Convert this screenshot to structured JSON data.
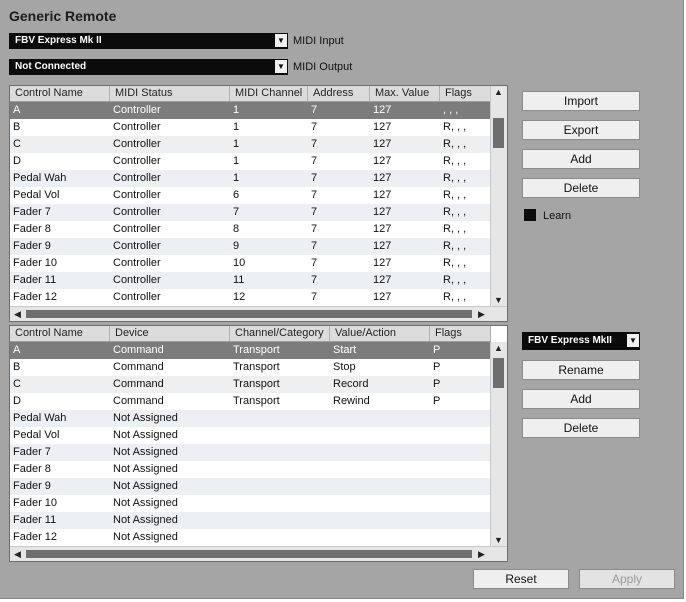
{
  "title": "Generic Remote",
  "midi_input": {
    "value": "FBV Express Mk II",
    "label": "MIDI Input"
  },
  "midi_output": {
    "value": "Not Connected",
    "label": "MIDI Output"
  },
  "top_table": {
    "headers": [
      "Control Name",
      "MIDI Status",
      "MIDI Channel",
      "Address",
      "Max. Value",
      "Flags"
    ],
    "rows": [
      [
        "A",
        "Controller",
        "1",
        "7",
        "127",
        ", , ,"
      ],
      [
        "B",
        "Controller",
        "1",
        "7",
        "127",
        "R, , ,"
      ],
      [
        "C",
        "Controller",
        "1",
        "7",
        "127",
        "R, , ,"
      ],
      [
        "D",
        "Controller",
        "1",
        "7",
        "127",
        "R, , ,"
      ],
      [
        "Pedal Wah",
        "Controller",
        "1",
        "7",
        "127",
        "R, , ,"
      ],
      [
        "Pedal Vol",
        "Controller",
        "6",
        "7",
        "127",
        "R, , ,"
      ],
      [
        "Fader 7",
        "Controller",
        "7",
        "7",
        "127",
        "R, , ,"
      ],
      [
        "Fader 8",
        "Controller",
        "8",
        "7",
        "127",
        "R, , ,"
      ],
      [
        "Fader 9",
        "Controller",
        "9",
        "7",
        "127",
        "R, , ,"
      ],
      [
        "Fader 10",
        "Controller",
        "10",
        "7",
        "127",
        "R, , ,"
      ],
      [
        "Fader 11",
        "Controller",
        "11",
        "7",
        "127",
        "R, , ,"
      ],
      [
        "Fader 12",
        "Controller",
        "12",
        "7",
        "127",
        "R, , ,"
      ]
    ]
  },
  "top_buttons": {
    "import": "Import",
    "export": "Export",
    "add": "Add",
    "delete": "Delete"
  },
  "learn_label": "Learn",
  "bottom_table": {
    "headers": [
      "Control Name",
      "Device",
      "Channel/Category",
      "Value/Action",
      "Flags"
    ],
    "rows": [
      [
        "A",
        "Command",
        "Transport",
        "Start",
        "P"
      ],
      [
        "B",
        "Command",
        "Transport",
        "Stop",
        "P"
      ],
      [
        "C",
        "Command",
        "Transport",
        "Record",
        "P"
      ],
      [
        "D",
        "Command",
        "Transport",
        "Rewind",
        "P"
      ],
      [
        "Pedal Wah",
        "Not Assigned",
        "",
        "",
        ""
      ],
      [
        "Pedal Vol",
        "Not Assigned",
        "",
        "",
        ""
      ],
      [
        "Fader 7",
        "Not Assigned",
        "",
        "",
        ""
      ],
      [
        "Fader 8",
        "Not Assigned",
        "",
        "",
        ""
      ],
      [
        "Fader 9",
        "Not Assigned",
        "",
        "",
        ""
      ],
      [
        "Fader 10",
        "Not Assigned",
        "",
        "",
        ""
      ],
      [
        "Fader 11",
        "Not Assigned",
        "",
        "",
        ""
      ],
      [
        "Fader 12",
        "Not Assigned",
        "",
        "",
        ""
      ]
    ]
  },
  "bank_select": {
    "value": "FBV Express MkII"
  },
  "bottom_buttons": {
    "rename": "Rename",
    "add": "Add",
    "delete": "Delete"
  },
  "footer": {
    "reset": "Reset",
    "apply": "Apply"
  },
  "icons": {
    "dropdown": "chevron-down-icon",
    "up": "arrow-up-icon",
    "down": "arrow-down-icon",
    "left": "arrow-left-icon",
    "right": "arrow-right-icon"
  }
}
